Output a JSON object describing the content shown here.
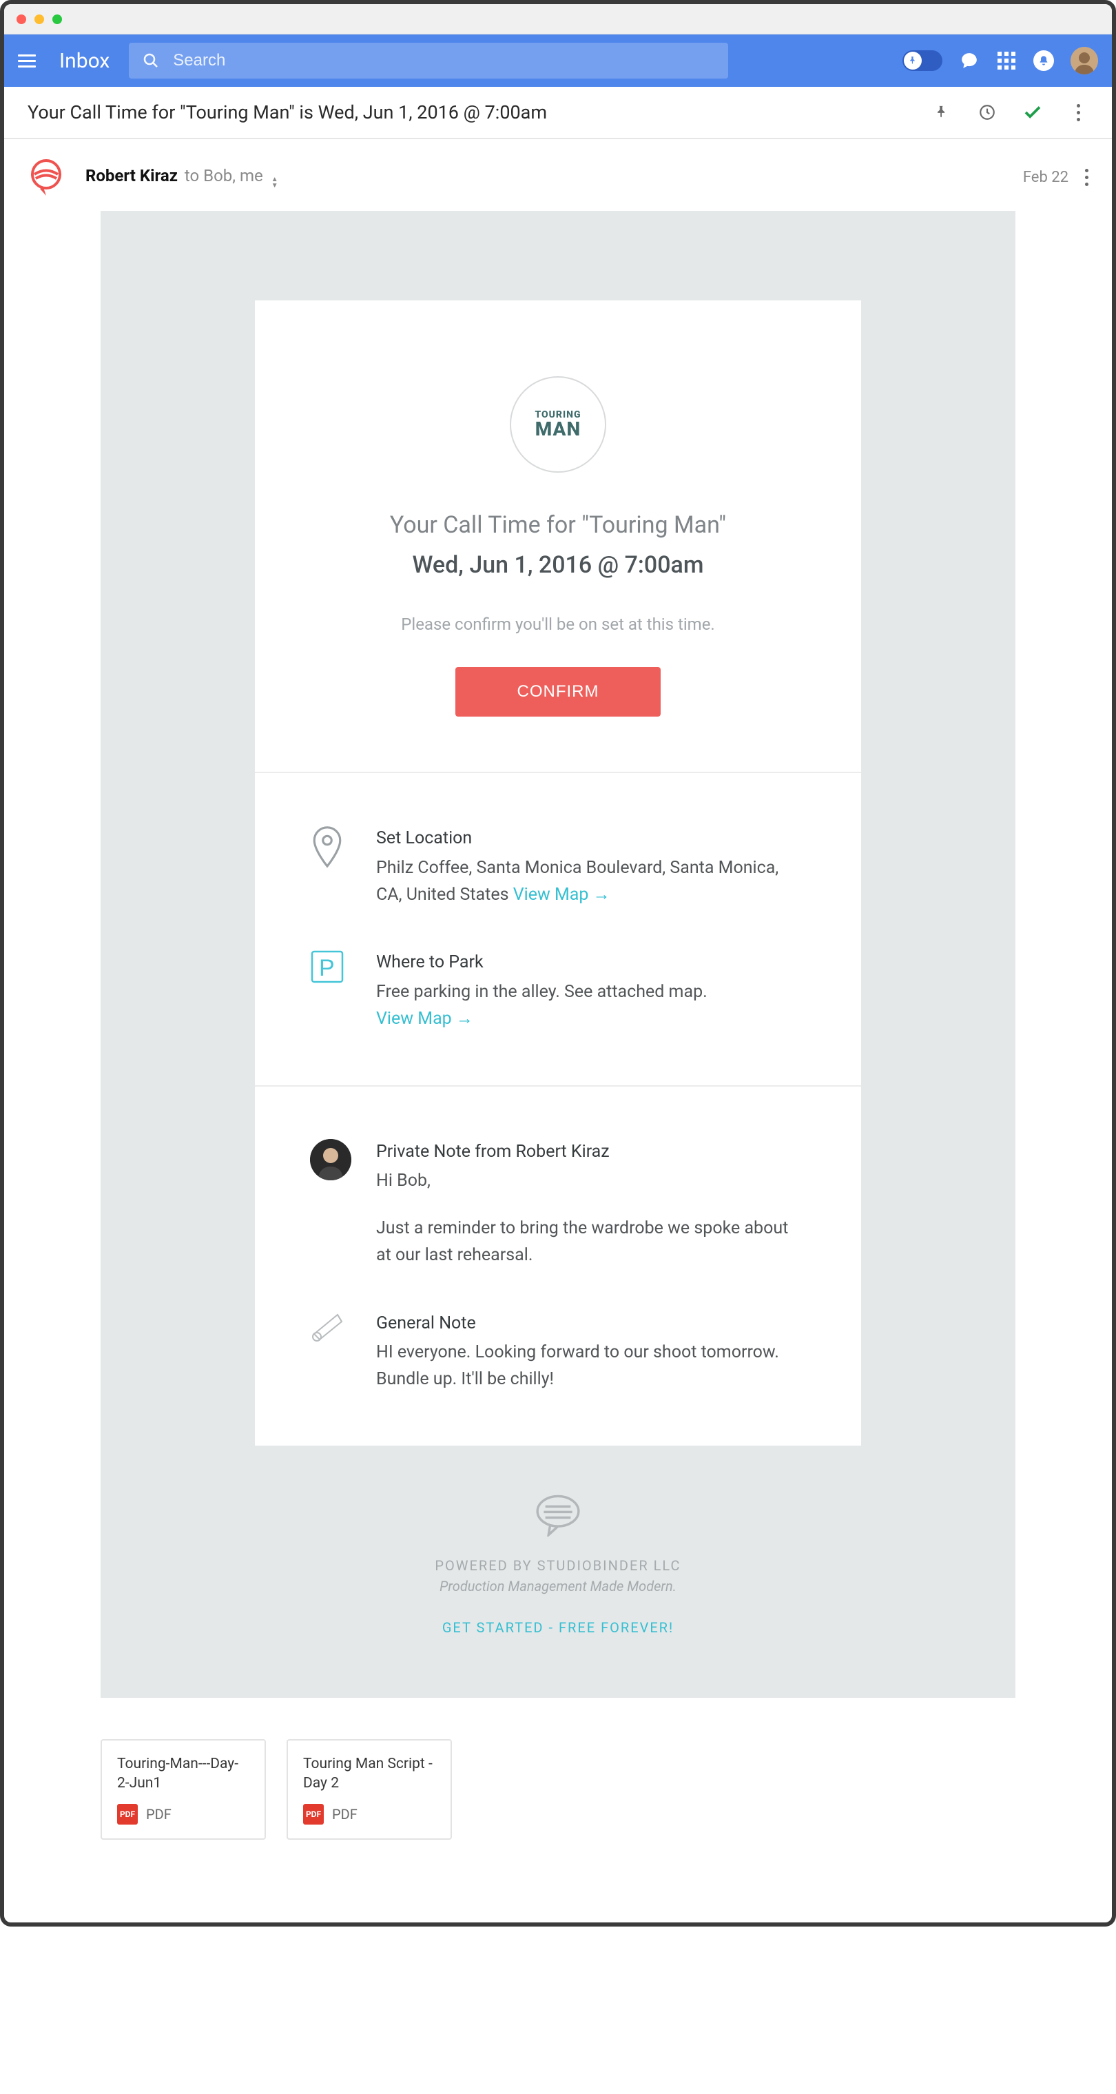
{
  "header": {
    "app_label": "Inbox",
    "search_placeholder": "Search"
  },
  "subject_bar": {
    "subject": "Your Call Time for \"Touring Man\" is Wed, Jun 1, 2016 @ 7:00am"
  },
  "sender": {
    "name": "Robert Kiraz",
    "to": "to Bob, me",
    "date": "Feb 22"
  },
  "email": {
    "logo_line1": "TOURING",
    "logo_line2": "MAN",
    "title_line1": "Your Call Time for \"Touring Man\"",
    "title_line2": "Wed, Jun 1, 2016 @ 7:00am",
    "subtitle": "Please confirm you'll be on set at this time.",
    "confirm_label": "CONFIRM",
    "location": {
      "heading": "Set Location",
      "body": "Philz Coffee, Santa Monica Boulevard, Santa Monica, CA, United States",
      "link": "View Map →"
    },
    "parking": {
      "heading": "Where to Park",
      "body": "Free parking in the alley. See attached map.",
      "link": "View Map →"
    },
    "private_note": {
      "heading": "Private Note from Robert Kiraz",
      "line1": "Hi Bob,",
      "line2": "Just a reminder to bring the wardrobe we spoke about at our last rehearsal."
    },
    "general_note": {
      "heading": "General Note",
      "body": "HI everyone. Looking forward to our shoot tomorrow. Bundle up. It'll be chilly!"
    }
  },
  "footer": {
    "line1": "POWERED BY STUDIOBINDER LLC",
    "line2": "Production Management Made Modern.",
    "cta": "GET STARTED - FREE FOREVER!"
  },
  "attachments": [
    {
      "name": "Touring-Man---Day-2-Jun1",
      "type": "PDF"
    },
    {
      "name": "Touring Man Script - Day 2",
      "type": "PDF"
    }
  ]
}
